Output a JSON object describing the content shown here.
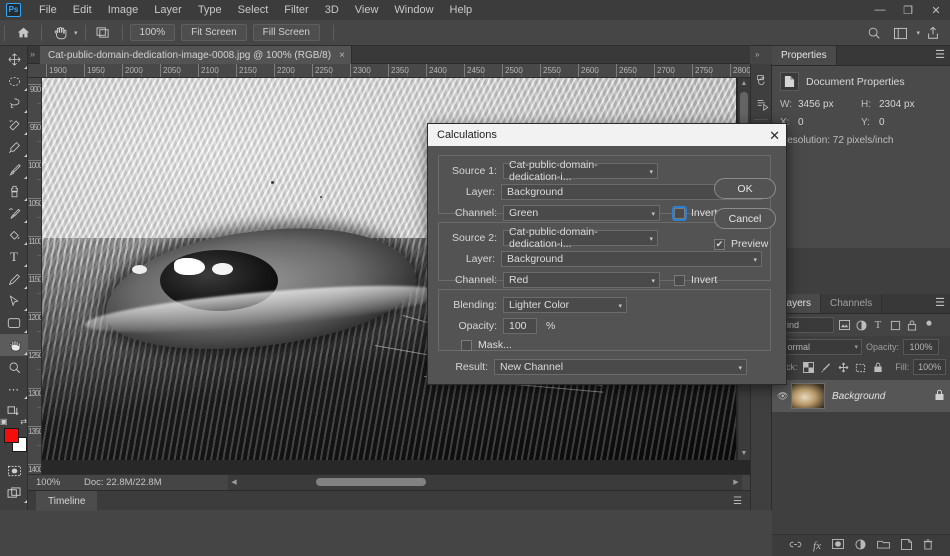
{
  "app": {
    "logo": "Ps",
    "menus": [
      "File",
      "Edit",
      "Image",
      "Layer",
      "Type",
      "Select",
      "Filter",
      "3D",
      "View",
      "Window",
      "Help"
    ],
    "window_controls": {
      "minimize": "—",
      "restore": "❐",
      "close": "✕"
    }
  },
  "options_bar": {
    "home_icon": "home-icon",
    "tool_icon": "hand-tool-icon",
    "arrange_icon": "arrange-documents-icon",
    "zoom_100": "100%",
    "fit_screen": "Fit Screen",
    "fill_screen": "Fill Screen",
    "search_icon": "search-icon",
    "workspace_icon": "workspace-icon",
    "share_icon": "share-icon"
  },
  "toolbar": {
    "tools": [
      {
        "name": "move-tool",
        "glyph": "✥"
      },
      {
        "name": "marquee-tool",
        "glyph": "○"
      },
      {
        "name": "lasso-tool",
        "glyph": "☂"
      },
      {
        "name": "quick-selection-tool",
        "glyph": "✎"
      },
      {
        "name": "crop-tool",
        "glyph": "✀"
      },
      {
        "name": "eyedropper-tool",
        "glyph": "✒"
      },
      {
        "name": "healing-brush-tool",
        "glyph": "✐"
      },
      {
        "name": "brush-tool",
        "glyph": "✏"
      },
      {
        "name": "clone-stamp-tool",
        "glyph": "⚑"
      },
      {
        "name": "history-brush-tool",
        "glyph": "➶"
      },
      {
        "name": "eraser-tool",
        "glyph": "◢"
      },
      {
        "name": "gradient-tool",
        "glyph": "▧"
      },
      {
        "name": "type-tool",
        "glyph": "T"
      },
      {
        "name": "pen-tool",
        "glyph": "☂"
      },
      {
        "name": "path-selection-tool",
        "glyph": "➤"
      },
      {
        "name": "rectangle-tool",
        "glyph": "▭"
      },
      {
        "name": "hand-tool",
        "glyph": "✋"
      },
      {
        "name": "zoom-tool",
        "glyph": "⌕"
      },
      {
        "name": "more-tools",
        "glyph": "•••"
      },
      {
        "name": "edit-toolbar",
        "glyph": "❐"
      }
    ],
    "foreground_color": "#f40d0d",
    "background_color": "#fefefe",
    "quick_mask": "quick-mask-icon",
    "screen_mode": "screen-mode-icon"
  },
  "document": {
    "tab_title": "Cat-public-domain-dedication-image-0008.jpg @ 100% (RGB/8)",
    "tab_close": "×",
    "ruler_h_ticks": [
      "1900",
      "1950",
      "2000",
      "2050",
      "2100",
      "2150",
      "2200",
      "2250",
      "2300",
      "2350",
      "2400",
      "2450",
      "2500",
      "2550",
      "2600",
      "2650",
      "2700",
      "2750",
      "2800"
    ],
    "ruler_v_ticks": [
      "900",
      "950",
      "1000",
      "1050",
      "1100",
      "1150",
      "1200",
      "1250",
      "1300",
      "1350",
      "1400"
    ]
  },
  "status_bar": {
    "zoom": "100%",
    "doc_size": "Doc: 22.8M/22.8M",
    "chevron_right": "❯",
    "chevron_left": "❮"
  },
  "timeline": {
    "tab": "Timeline",
    "menu_icon": "panel-menu-icon"
  },
  "rail": {
    "items": [
      {
        "name": "history-panel-icon",
        "glyph": "↺"
      },
      {
        "name": "actions-panel-icon",
        "glyph": "▶"
      },
      {
        "name": "brush-settings-icon",
        "glyph": "✏"
      },
      {
        "name": "adjustments-icon",
        "glyph": "◑"
      }
    ]
  },
  "properties_panel": {
    "tabs": [
      {
        "label": "Properties",
        "active": true
      }
    ],
    "menu_icon": "panel-menu-icon",
    "header_icon": "document-icon",
    "header": "Document Properties",
    "width_label": "W:",
    "width_value": "3456 px",
    "height_label": "H:",
    "height_value": "2304 px",
    "x_label": "X:",
    "x_value": "0",
    "y_label": "Y:",
    "y_value": "0",
    "resolution": "Resolution: 72 pixels/inch"
  },
  "layers_panel": {
    "tabs": [
      {
        "label": "Layers",
        "active": true
      },
      {
        "label": "Channels",
        "active": false
      }
    ],
    "menu_icon": "panel-menu-icon",
    "filter_kind": "Kind",
    "filter_icons": [
      "pixel-filter-icon",
      "adjustment-filter-icon",
      "type-filter-icon",
      "shape-filter-icon",
      "smart-filter-icon",
      "toggle-filter-icon"
    ],
    "blend_mode": "Normal",
    "opacity_label": "Opacity:",
    "opacity_value": "100%",
    "lock_label": "Lock:",
    "lock_icons": [
      "lock-transparency-icon",
      "lock-image-icon",
      "lock-position-icon",
      "lock-artboard-icon",
      "lock-all-icon"
    ],
    "fill_label": "Fill:",
    "fill_value": "100%",
    "layer_name": "Background",
    "layer_lock_icon": "lock-icon",
    "footer_icons": [
      "link-layers-icon",
      "fx-icon",
      "add-mask-icon",
      "adjustment-layer-icon",
      "new-group-icon",
      "new-layer-icon",
      "delete-layer-icon"
    ],
    "footer_glyphs": [
      "∞",
      "fx",
      "▣",
      "◑",
      "▰",
      "⧉",
      "Ὕ1"
    ]
  },
  "dialog": {
    "title": "Calculations",
    "close": "✕",
    "source1": {
      "label": "Source 1:",
      "value": "Cat-public-domain-dedication-i...",
      "layer_label": "Layer:",
      "layer_value": "Background",
      "channel_label": "Channel:",
      "channel_value": "Green",
      "invert_label": "Invert",
      "invert_checked": false
    },
    "source2": {
      "label": "Source 2:",
      "value": "Cat-public-domain-dedication-i...",
      "layer_label": "Layer:",
      "layer_value": "Background",
      "channel_label": "Channel:",
      "channel_value": "Red",
      "invert_label": "Invert",
      "invert_checked": false
    },
    "blending_label": "Blending:",
    "blending_value": "Lighter Color",
    "opacity_label": "Opacity:",
    "opacity_value": "100",
    "percent": "%",
    "mask_label": "Mask...",
    "mask_checked": false,
    "result_label": "Result:",
    "result_value": "New Channel",
    "ok": "OK",
    "cancel": "Cancel",
    "preview_label": "Preview",
    "preview_checked": true,
    "check_glyph": "✔"
  },
  "colors": {
    "accent": "#31a8ff",
    "focus_ring": "#2a7fd4",
    "panel_bg": "#3f3f3f",
    "dialog_bg": "#535353"
  }
}
